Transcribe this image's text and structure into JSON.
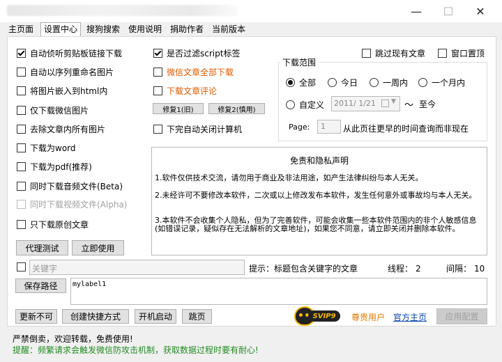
{
  "window": {
    "minimize": "—",
    "maximize": "☐",
    "close": "✕"
  },
  "tabs": [
    "主页面",
    "设置中心",
    "搜狗搜索",
    "使用说明",
    "捐助作者",
    "当前版本"
  ],
  "options": {
    "auto_clipboard": "自动侦听剪贴板链接下载",
    "auto_rename": "自动以序列重命名图片",
    "embed_html": "将图片嵌入到html内",
    "wechat_img_only": "仅下载微信图片",
    "remove_images": "去除文章内所有图片",
    "as_word": "下载为word",
    "as_pdf": "下载为pdf(推荐)",
    "audio": "同时下载音频文件(Beta)",
    "video": "同时下载视频文件(Alpha)",
    "original_only": "只下载原创文章",
    "filter_script": "是否过滤script标签",
    "download_all": "微信文章全部下载",
    "comments": "下载文章评论",
    "shutdown": "下完自动关闭计算机",
    "skip_existing": "跳过现有文章",
    "window_top": "窗口置顶"
  },
  "fix_buttons": {
    "fix1": "修复1(旧)",
    "fix2": "修复2(慎用)"
  },
  "proxy_buttons": {
    "test": "代理测试",
    "use": "立即使用"
  },
  "range": {
    "legend": "下载范围",
    "all": "全部",
    "today": "今日",
    "week": "一周内",
    "month": "一个月内",
    "custom": "自定义",
    "date": "2011/ 1/21",
    "tilde": "～",
    "to_now": "至今",
    "page_label": "Page:",
    "page_value": "1",
    "page_hint": "从此页往更早的时间查询而非现在"
  },
  "disclaimer": {
    "title": "免责和隐私声明",
    "p1": "1.软件仅供技术交流，请勿用于商业及非法用途，如产生法律纠纷与本人无关。",
    "p2": "2.未经许可不要修改本软件，二次或以上修改发布本软件，发生任何意外或事故均与本人无关。",
    "p3": "3.本软件不会收集个人隐私，但为了完善软件，可能会收集一些本软件范围内的非个人敏感信息(如错误记录，疑似存在无法解析的文章地址)，如果您不同意，请立即关闭并删除本软件。"
  },
  "keyword": {
    "placeholder": "关键字",
    "hint": "提示：标题包含关键字的文章",
    "threads_label": "线程：",
    "threads": "2",
    "interval_label": "间隔：",
    "interval": "10"
  },
  "save": {
    "button": "保存路径",
    "value": "mylabel1"
  },
  "bottom_buttons": {
    "update": "更新不可",
    "shortcut": "创建快捷方式",
    "autostart": "开机启动",
    "jump": "跳页",
    "apply": "应用配置"
  },
  "vip": {
    "badge": "SVIP9",
    "user": "尊贵用户",
    "homepage": "官方主页"
  },
  "footer": {
    "line1": "严禁倒卖，欢迎转载，免费使用!",
    "line2": "提醒：频繁请求会触发微信防攻击机制，获取数据过程时要有耐心!"
  },
  "colors": {
    "orange": "#e05a00",
    "link": "#0645ad",
    "vip": "#e07b00",
    "reminder": "#228b22"
  }
}
